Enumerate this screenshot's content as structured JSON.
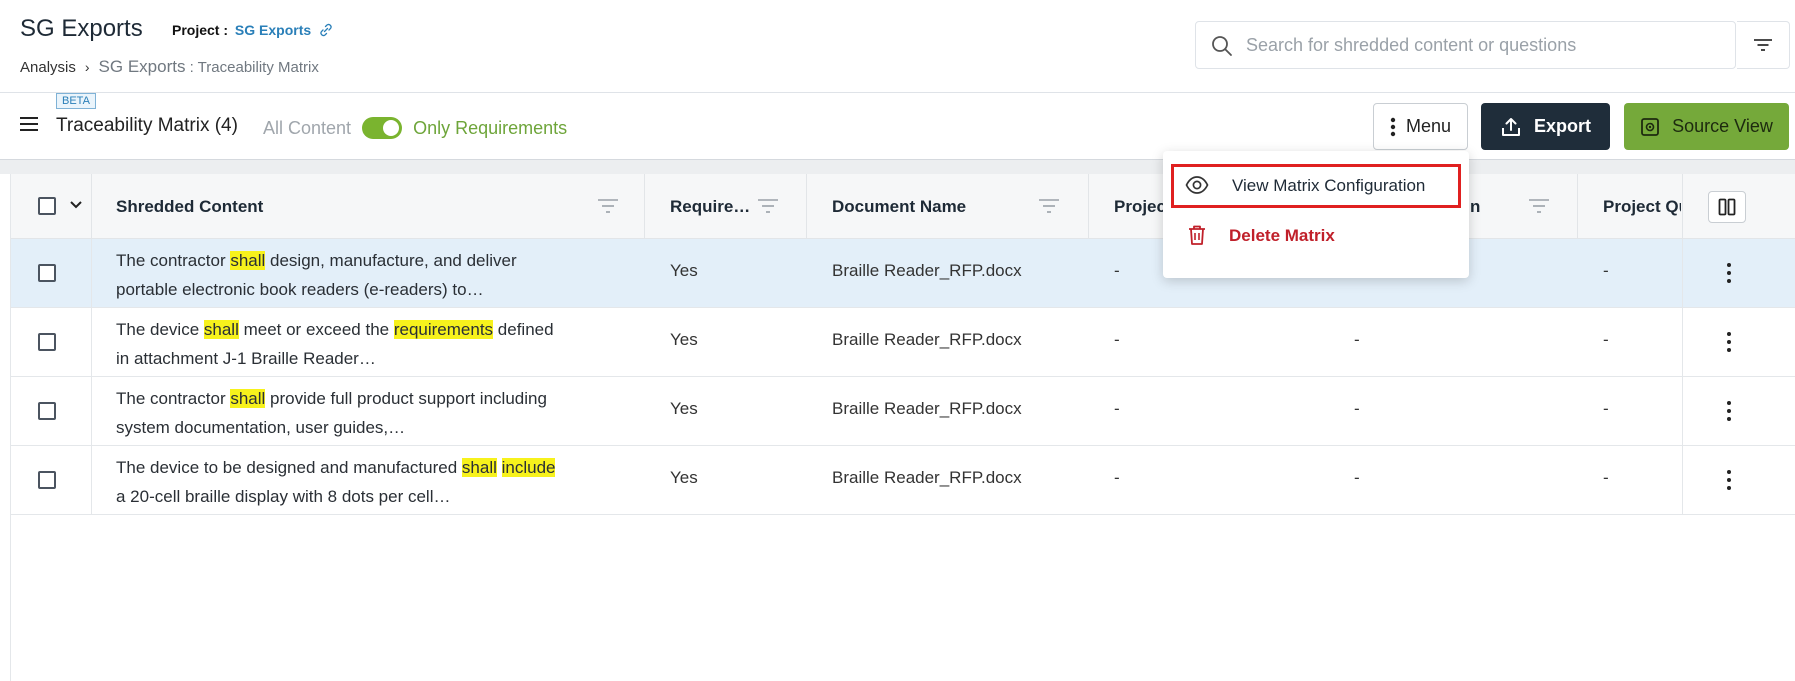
{
  "header": {
    "app_title": "SG Exports",
    "project_label": "Project :",
    "project_link": "SG Exports",
    "breadcrumb": {
      "root": "Analysis",
      "current_main": "SG Exports",
      "current_sub": " : Traceability Matrix"
    },
    "search": {
      "placeholder": "Search for shredded content or questions"
    }
  },
  "toolbar": {
    "beta": "BETA",
    "title": "Traceability Matrix (4)",
    "toggle_off_label": "All Content",
    "toggle_on_label": "Only Requirements",
    "toggle_state": "on",
    "menu_label": "Menu",
    "export_label": "Export",
    "source_view_label": "Source View"
  },
  "colors": {
    "accent_green": "#75a93a",
    "dark_button": "#1f2d3a",
    "highlight": "#f7f21c",
    "selected_row": "#e3eff9",
    "danger": "#c0202a",
    "link": "#2a7fb8"
  },
  "table": {
    "columns": [
      "Shredded Content",
      "Require…",
      "Document Name",
      "Projec",
      "n",
      "Project Qu"
    ],
    "rows": [
      {
        "content": [
          {
            "t": "The contractor "
          },
          {
            "t": "shall",
            "hl": true
          },
          {
            "t": " design, manufacture, and deliver portable electronic book readers (e-readers) to…"
          }
        ],
        "requirement": "Yes",
        "document": "Braille Reader_RFP.docx",
        "col4": "-",
        "col5": "",
        "col6": "-",
        "selected": true
      },
      {
        "content": [
          {
            "t": "The device "
          },
          {
            "t": "shall",
            "hl": true
          },
          {
            "t": " meet or exceed the "
          },
          {
            "t": "requirements",
            "hl": true
          },
          {
            "t": " defined in attachment J-1 Braille Reader…"
          }
        ],
        "requirement": "Yes",
        "document": "Braille Reader_RFP.docx",
        "col4": "-",
        "col5": "-",
        "col6": "-",
        "selected": false
      },
      {
        "content": [
          {
            "t": "The contractor "
          },
          {
            "t": "shall",
            "hl": true
          },
          {
            "t": " provide full product support including system documentation, user guides,…"
          }
        ],
        "requirement": "Yes",
        "document": "Braille Reader_RFP.docx",
        "col4": "-",
        "col5": "-",
        "col6": "-",
        "selected": false
      },
      {
        "content": [
          {
            "t": "The device to be designed and manufactured "
          },
          {
            "t": "shall",
            "hl": true
          },
          {
            "t": " "
          },
          {
            "t": "include",
            "hl": true
          },
          {
            "t": " a 20-cell braille display with 8 dots per cell…"
          }
        ],
        "requirement": "Yes",
        "document": "Braille Reader_RFP.docx",
        "col4": "-",
        "col5": "-",
        "col6": "-",
        "selected": false
      }
    ]
  },
  "dropdown": {
    "view_config": "View Matrix Configuration",
    "delete": "Delete Matrix"
  }
}
